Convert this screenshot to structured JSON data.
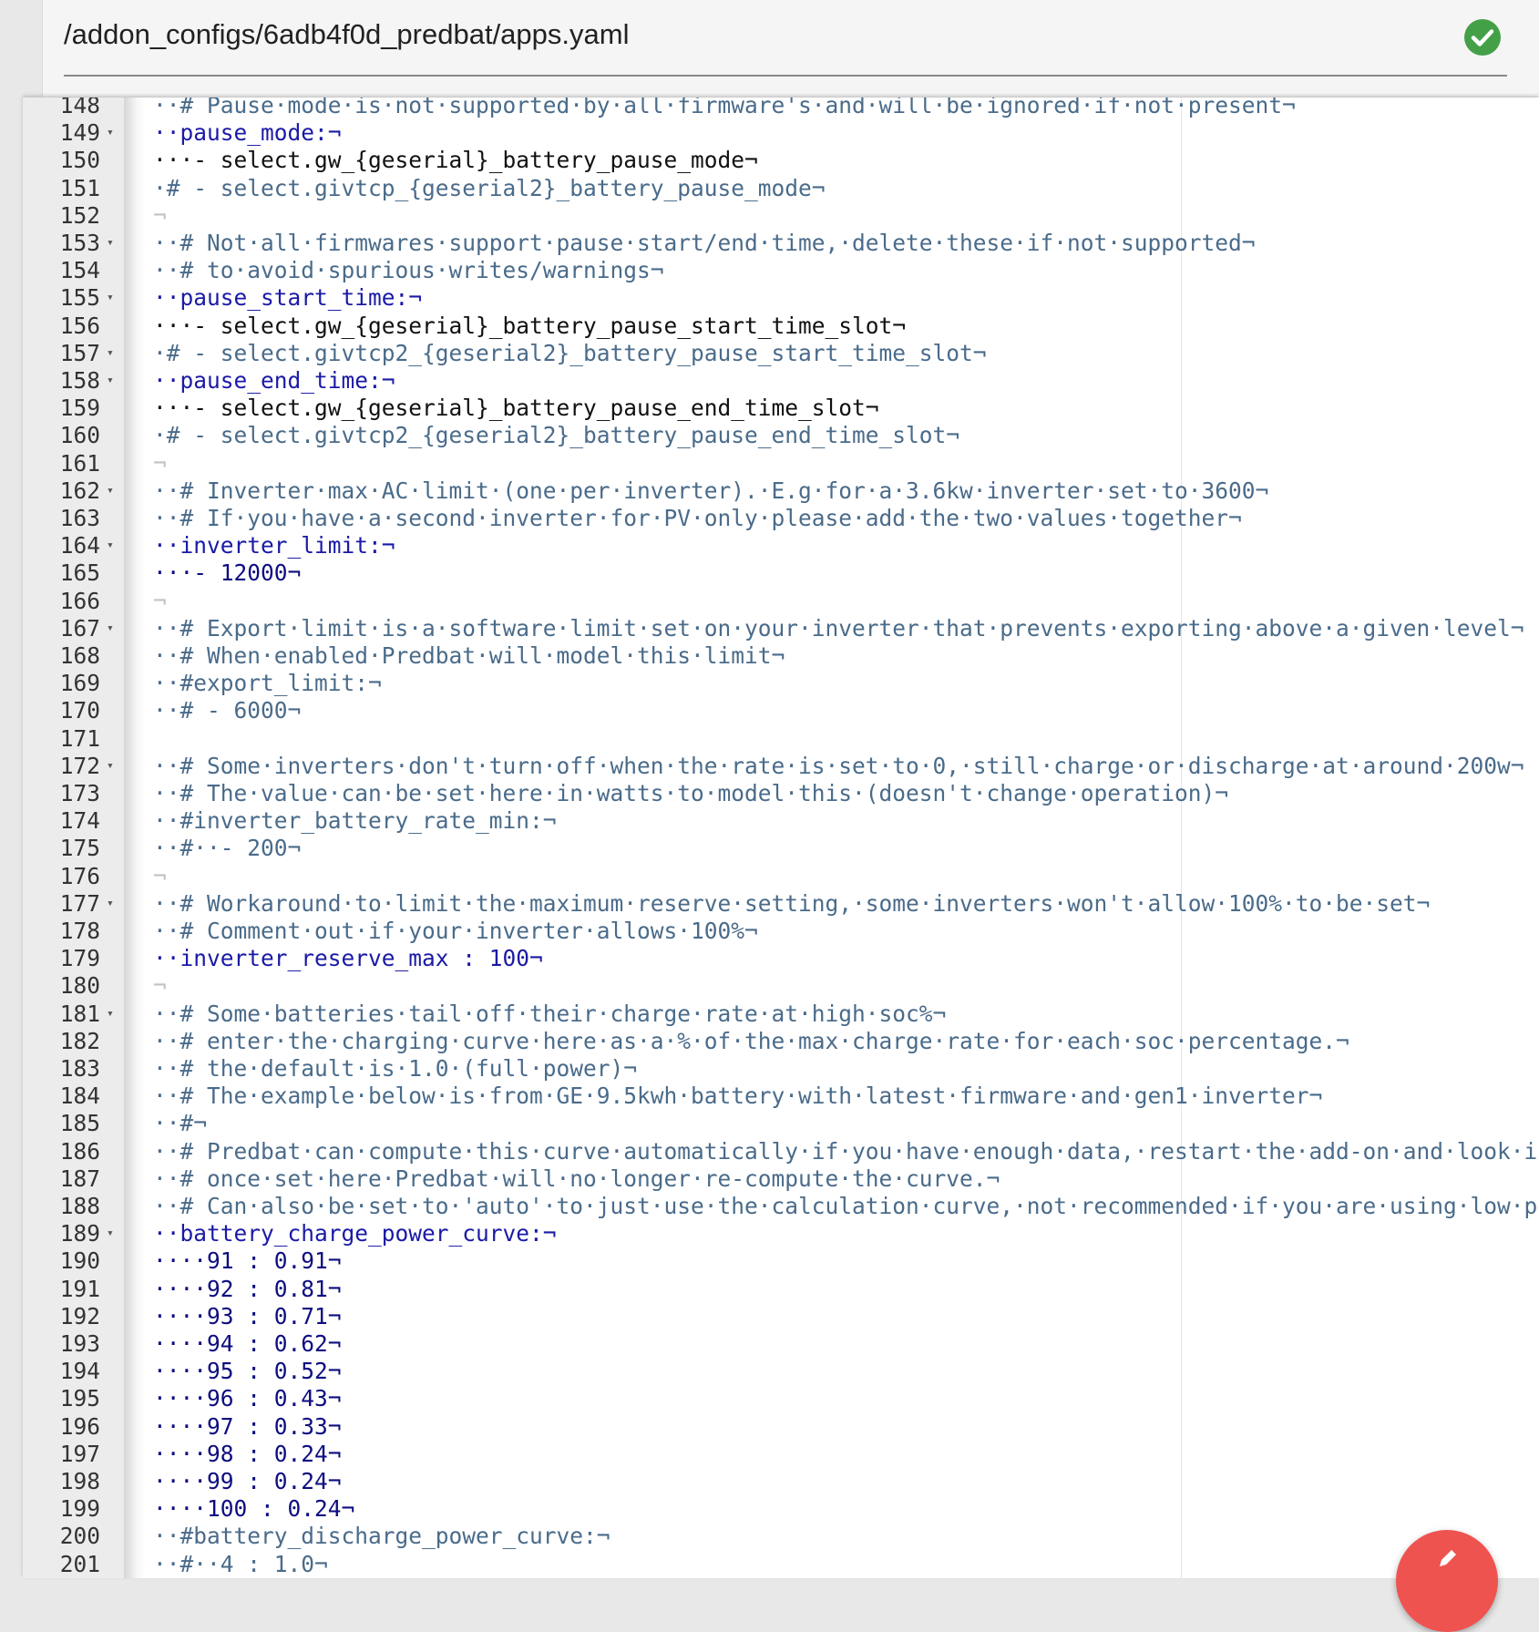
{
  "header": {
    "file_path": "/addon_configs/6adb4f0d_predbat/apps.yaml",
    "status_icon": "check-circle-icon",
    "status_color": "#43a047"
  },
  "editor": {
    "lines": [
      {
        "n": "148",
        "fold": false,
        "kind": "comment",
        "text": "··# Pause·mode·is·not·supported·by·all·firmware's·and·will·be·ignored·if·not·present¬"
      },
      {
        "n": "149",
        "fold": true,
        "kind": "key",
        "text": "··pause_mode:¬"
      },
      {
        "n": "150",
        "fold": false,
        "kind": "text",
        "text": "···- select.gw_{geserial}_battery_pause_mode¬"
      },
      {
        "n": "151",
        "fold": false,
        "kind": "comment",
        "text": "·# - select.givtcp_{geserial2}_battery_pause_mode¬"
      },
      {
        "n": "152",
        "fold": false,
        "kind": "blank",
        "text": "¬"
      },
      {
        "n": "153",
        "fold": true,
        "kind": "comment",
        "text": "··# Not·all·firmwares·support·pause·start/end·time,·delete·these·if·not·supported¬"
      },
      {
        "n": "154",
        "fold": false,
        "kind": "comment",
        "text": "··# to·avoid·spurious·writes/warnings¬"
      },
      {
        "n": "155",
        "fold": true,
        "kind": "key",
        "text": "··pause_start_time:¬"
      },
      {
        "n": "156",
        "fold": false,
        "kind": "text",
        "text": "···- select.gw_{geserial}_battery_pause_start_time_slot¬"
      },
      {
        "n": "157",
        "fold": true,
        "kind": "comment",
        "text": "·# - select.givtcp2_{geserial2}_battery_pause_start_time_slot¬"
      },
      {
        "n": "158",
        "fold": true,
        "kind": "key",
        "text": "··pause_end_time:¬"
      },
      {
        "n": "159",
        "fold": false,
        "kind": "text",
        "text": "···- select.gw_{geserial}_battery_pause_end_time_slot¬"
      },
      {
        "n": "160",
        "fold": false,
        "kind": "comment",
        "text": "·# - select.givtcp2_{geserial2}_battery_pause_end_time_slot¬"
      },
      {
        "n": "161",
        "fold": false,
        "kind": "blank",
        "text": "¬"
      },
      {
        "n": "162",
        "fold": true,
        "kind": "comment",
        "text": "··# Inverter·max·AC·limit·(one·per·inverter).·E.g·for·a·3.6kw·inverter·set·to·3600¬"
      },
      {
        "n": "163",
        "fold": false,
        "kind": "comment",
        "text": "··# If·you·have·a·second·inverter·for·PV·only·please·add·the·two·values·together¬"
      },
      {
        "n": "164",
        "fold": true,
        "kind": "key",
        "text": "··inverter_limit:¬"
      },
      {
        "n": "165",
        "fold": false,
        "kind": "num",
        "text": "···- 12000¬"
      },
      {
        "n": "166",
        "fold": false,
        "kind": "blank",
        "text": "¬"
      },
      {
        "n": "167",
        "fold": true,
        "kind": "comment",
        "text": "··# Export·limit·is·a·software·limit·set·on·your·inverter·that·prevents·exporting·above·a·given·level¬"
      },
      {
        "n": "168",
        "fold": false,
        "kind": "comment",
        "text": "··# When·enabled·Predbat·will·model·this·limit¬"
      },
      {
        "n": "169",
        "fold": false,
        "kind": "comment",
        "text": "··#export_limit:¬"
      },
      {
        "n": "170",
        "fold": false,
        "kind": "comment",
        "text": "··# - 6000¬"
      },
      {
        "n": "171",
        "fold": false,
        "kind": "blank",
        "text": ""
      },
      {
        "n": "172",
        "fold": true,
        "kind": "comment",
        "text": "··# Some·inverters·don't·turn·off·when·the·rate·is·set·to·0,·still·charge·or·discharge·at·around·200w¬"
      },
      {
        "n": "173",
        "fold": false,
        "kind": "comment",
        "text": "··# The·value·can·be·set·here·in·watts·to·model·this·(doesn't·change·operation)¬"
      },
      {
        "n": "174",
        "fold": false,
        "kind": "comment",
        "text": "··#inverter_battery_rate_min:¬"
      },
      {
        "n": "175",
        "fold": false,
        "kind": "comment",
        "text": "··#··- 200¬"
      },
      {
        "n": "176",
        "fold": false,
        "kind": "blank",
        "text": "¬"
      },
      {
        "n": "177",
        "fold": true,
        "kind": "comment",
        "text": "··# Workaround·to·limit·the·maximum·reserve·setting,·some·inverters·won't·allow·100%·to·be·set¬"
      },
      {
        "n": "178",
        "fold": false,
        "kind": "comment",
        "text": "··# Comment·out·if·your·inverter·allows·100%¬"
      },
      {
        "n": "179",
        "fold": false,
        "kind": "key",
        "text": "··inverter_reserve_max : 100¬"
      },
      {
        "n": "180",
        "fold": false,
        "kind": "blank",
        "text": "¬"
      },
      {
        "n": "181",
        "fold": true,
        "kind": "comment",
        "text": "··# Some·batteries·tail·off·their·charge·rate·at·high·soc%¬"
      },
      {
        "n": "182",
        "fold": false,
        "kind": "comment",
        "text": "··# enter·the·charging·curve·here·as·a·%·of·the·max·charge·rate·for·each·soc·percentage.¬"
      },
      {
        "n": "183",
        "fold": false,
        "kind": "comment",
        "text": "··# the·default·is·1.0·(full·power)¬"
      },
      {
        "n": "184",
        "fold": false,
        "kind": "comment",
        "text": "··# The·example·below·is·from·GE·9.5kwh·battery·with·latest·firmware·and·gen1·inverter¬"
      },
      {
        "n": "185",
        "fold": false,
        "kind": "comment",
        "text": "··#¬"
      },
      {
        "n": "186",
        "fold": false,
        "kind": "comment",
        "text": "··# Predbat·can·compute·this·curve·automatically·if·you·have·enough·data,·restart·the·add-on·and·look·in·the"
      },
      {
        "n": "187",
        "fold": false,
        "kind": "comment",
        "text": "··# once·set·here·Predbat·will·no·longer·re-compute·the·curve.¬"
      },
      {
        "n": "188",
        "fold": false,
        "kind": "comment",
        "text": "··# Can·also·be·set·to·'auto'·to·just·use·the·calculation·curve,·not·recommended·if·you·are·using·low·power"
      },
      {
        "n": "189",
        "fold": true,
        "kind": "key",
        "text": "··battery_charge_power_curve:¬"
      },
      {
        "n": "190",
        "fold": false,
        "kind": "num",
        "text": "····91 : 0.91¬"
      },
      {
        "n": "191",
        "fold": false,
        "kind": "num",
        "text": "····92 : 0.81¬"
      },
      {
        "n": "192",
        "fold": false,
        "kind": "num",
        "text": "····93 : 0.71¬"
      },
      {
        "n": "193",
        "fold": false,
        "kind": "num",
        "text": "····94 : 0.62¬"
      },
      {
        "n": "194",
        "fold": false,
        "kind": "num",
        "text": "····95 : 0.52¬"
      },
      {
        "n": "195",
        "fold": false,
        "kind": "num",
        "text": "····96 : 0.43¬"
      },
      {
        "n": "196",
        "fold": false,
        "kind": "num",
        "text": "····97 : 0.33¬"
      },
      {
        "n": "197",
        "fold": false,
        "kind": "num",
        "text": "····98 : 0.24¬"
      },
      {
        "n": "198",
        "fold": false,
        "kind": "num",
        "text": "····99 : 0.24¬"
      },
      {
        "n": "199",
        "fold": false,
        "kind": "num",
        "text": "····100 : 0.24¬"
      },
      {
        "n": "200",
        "fold": false,
        "kind": "comment",
        "text": "··#battery_discharge_power_curve:¬"
      },
      {
        "n": "201",
        "fold": false,
        "kind": "comment",
        "text": "··#··4 : 1.0¬"
      }
    ]
  },
  "fab": {
    "icon": "pencil-icon",
    "color": "#ef5350"
  }
}
